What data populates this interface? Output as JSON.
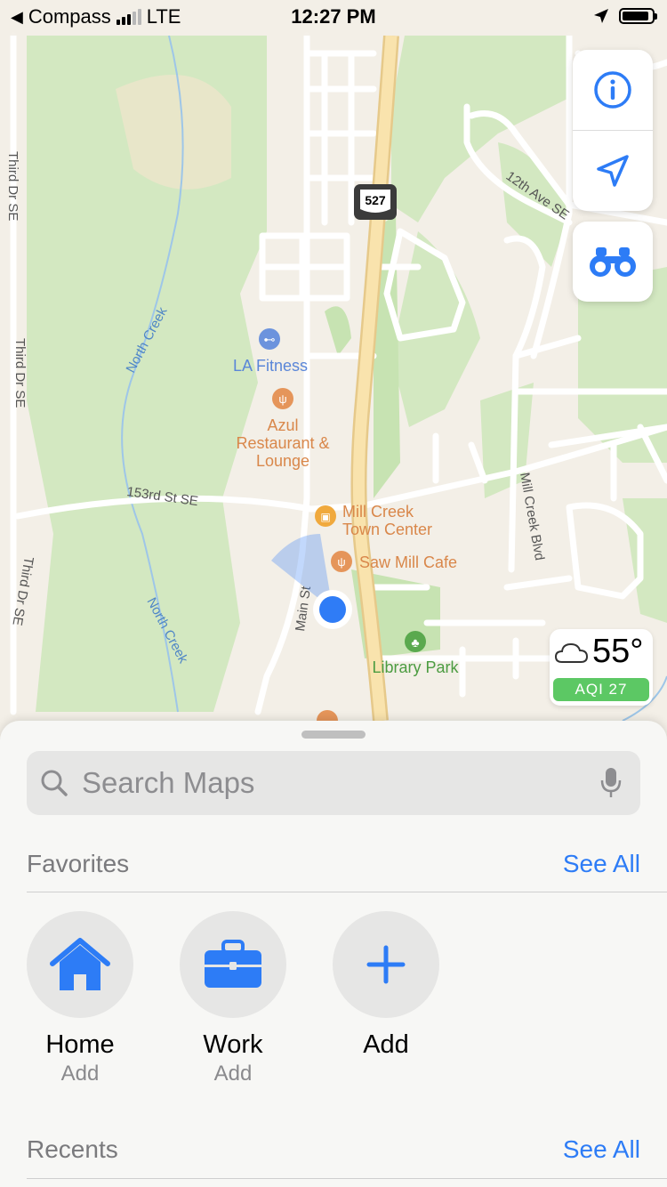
{
  "status_bar": {
    "back_app": "Compass",
    "network": "LTE",
    "time": "12:27 PM",
    "battery_level": 0.9
  },
  "map": {
    "road_labels": [
      "Third Dr SE",
      "Third Dr SE",
      "Third Dr SE",
      "North Creek",
      "North Creek",
      "153rd St SE",
      "Main St",
      "Mill Creek Blvd",
      "12th Ave SE"
    ],
    "highway_shield": "527",
    "pois": {
      "la_fitness": "LA Fitness",
      "azul_line1": "Azul",
      "azul_line2": "Restaurant &",
      "azul_line3": "Lounge",
      "mill_creek_line1": "Mill Creek",
      "mill_creek_line2": "Town Center",
      "saw_mill": "Saw Mill Cafe",
      "library_park": "Library Park"
    }
  },
  "map_controls": {
    "info": "info-icon",
    "location": "location-arrow-icon",
    "look_around": "binoculars-icon"
  },
  "weather": {
    "temperature": "55°",
    "aqi": "AQI 27"
  },
  "sheet": {
    "search_placeholder": "Search Maps",
    "favorites_title": "Favorites",
    "favorites_see_all": "See All",
    "favorites": [
      {
        "name": "Home",
        "sub": "Add",
        "icon": "house-icon"
      },
      {
        "name": "Work",
        "sub": "Add",
        "icon": "briefcase-icon"
      },
      {
        "name": "Add",
        "sub": "",
        "icon": "plus-icon"
      }
    ],
    "recents_title": "Recents",
    "recents_see_all": "See All"
  },
  "colors": {
    "accent": "#2d7cf6",
    "park": "#cfe6bb",
    "highway": "#f8dca0",
    "poi_food": "#e5955a",
    "poi_fitness": "#6c93dd",
    "poi_park": "#5aa94e",
    "aqi_good": "#5cc864"
  }
}
